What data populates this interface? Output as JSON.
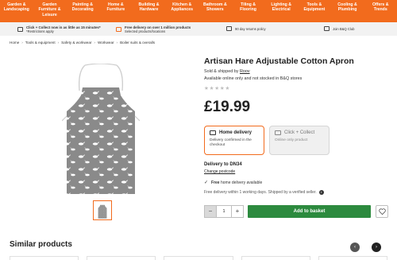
{
  "nav": {
    "items": [
      "Garden &\nLandscaping",
      "Garden\nFurniture &\nLeisure",
      "Painting &\nDecorating",
      "Home &\nFurniture",
      "Building &\nHardware",
      "Kitchen &\nAppliances",
      "Bathroom &\nShowers",
      "Tiling &\nFlooring",
      "Lighting &\nElectrical",
      "Tools &\nEquipment",
      "Cooling &\nPlumbing",
      "Offers &\nTrends"
    ]
  },
  "info_strip": {
    "click_collect": "Click + Collect now in as little as 15 minutes*",
    "click_collect_sub": "*Restrictions apply",
    "free_delivery": "Free delivery on over 1 million products",
    "free_delivery_sub": "Selected products/locations",
    "returns": "90 day returns policy",
    "club": "Join B&Q Club"
  },
  "breadcrumb": [
    "Home",
    "Tools & equipment",
    "Safety & workwear",
    "Workwear",
    "Boiler suits & overalls"
  ],
  "product": {
    "title": "Artisan Hare Adjustable Cotton Apron",
    "sold_by_prefix": "Sold & shipped by",
    "seller": "Roov",
    "availability": "Available online only and not stocked in B&Q stores",
    "rating_stars": "★★★★★",
    "price": "£19.99"
  },
  "delivery_options": {
    "home_label": "Home delivery",
    "home_sub": "Delivery confirmed in the checkout",
    "cc_label": "Click + Collect",
    "cc_sub": "Online only product"
  },
  "delivery": {
    "to": "Delivery to DN34",
    "change": "Change postcode",
    "free_home_bold": "Free",
    "free_home_rest": "home delivery available",
    "free_within": "Free delivery within 1 working days. Shipped by a verified seller."
  },
  "purchase": {
    "qty_minus": "−",
    "qty": "1",
    "qty_plus": "+",
    "add_to_basket": "Add to basket"
  },
  "similar": {
    "heading": "Similar products",
    "prev": "‹",
    "next": "›"
  },
  "colors": {
    "brand_orange": "#f26b1d",
    "cta_green": "#2c8a3e",
    "apron_grey": "#8a8a8a"
  }
}
